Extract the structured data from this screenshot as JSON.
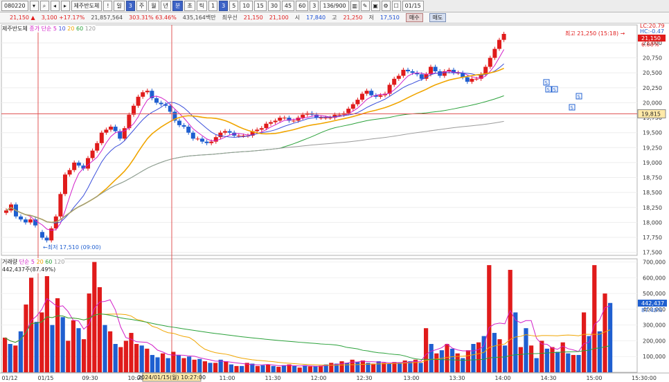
{
  "toolbar": {
    "code": "080220",
    "name": "제주반도체",
    "period_buttons": [
      "일",
      "주",
      "월",
      "년",
      "분",
      "초",
      "틱"
    ],
    "minute_buttons": [
      "1",
      "3",
      "5",
      "10",
      "15",
      "30",
      "45",
      "60"
    ],
    "interval_value": "3",
    "count_value": "136/900",
    "date_value": "01/15"
  },
  "info": {
    "price": "21,150 ▲",
    "change": "3,100 +17.17%",
    "volume": "21,857,564",
    "volume_ratio": "303.31% 63.46%",
    "amount": "435,164백만",
    "priority_label": "최우선",
    "priority_ask": "21,150",
    "priority_bid": "21,100",
    "open_label": "시",
    "open": "17,840",
    "high_label": "고",
    "high": "21,250",
    "low_label": "저",
    "low": "17,510",
    "sell_label": "매수",
    "buy_label": "매도"
  },
  "price_legend": {
    "name": "제주반도체",
    "ma_label": "종가 단순",
    "ma_periods": [
      "5",
      "10",
      "20",
      "60",
      "120"
    ]
  },
  "volume_legend": {
    "title": "거래량",
    "ma_label": "단순",
    "ma_periods": [
      "5",
      "20",
      "60",
      "120"
    ],
    "value": "442,437주(87.49%)"
  },
  "annotations": {
    "high": "최고 21,250 (15:18)",
    "low": "최저 17,510 (09:00)",
    "lc": "LC:20.79",
    "hc": "HC:-0.47",
    "current_price": "21,150",
    "current_pct": "6.08%",
    "crosshair_price": "19,815",
    "crosshair_time": "2024/01/15(월) 10:27:00",
    "volume_now": "442,437",
    "volume_pct": "87.49%",
    "signal_mark": "S"
  },
  "colors": {
    "up": "#e01b1b",
    "down": "#1f5fd0",
    "ma5": "#d21ec8",
    "ma10": "#3b4fdb",
    "ma20": "#f0a500",
    "ma60": "#2aa13a",
    "ma120": "#9a9a9a"
  },
  "chart_data": {
    "type": "candlestick",
    "price_axis": {
      "ticks": [
        "21,000",
        "20,750",
        "20,500",
        "20,250",
        "20,000",
        "19,750",
        "19,500",
        "19,250",
        "19,000",
        "18,750",
        "18,500",
        "18,250",
        "18,000",
        "17,750",
        "17,500"
      ]
    },
    "volume_axis": {
      "ticks": [
        "700,000",
        "600,000",
        "500,000",
        "400,000",
        "300,000",
        "200,000",
        "100,000"
      ]
    },
    "time_axis": {
      "labels": [
        "01/12",
        "01/15",
        "09:30",
        "10:00",
        "11:00",
        "11:30",
        "12:00",
        "12:30",
        "13:00",
        "13:30",
        "14:00",
        "14:30",
        "15:00",
        "15:30:00"
      ]
    },
    "session_close_prices": [
      18200,
      18300,
      18100,
      18050,
      18000,
      18050,
      17950
    ],
    "day_open": 17840,
    "close_path": [
      17700,
      18100,
      18800,
      19000,
      18900,
      19200,
      19500,
      19600,
      19400,
      19800,
      20100,
      20200,
      20000,
      19950,
      19700,
      19600,
      19400,
      19350,
      19350,
      19500,
      19500,
      19450,
      19450,
      19550,
      19650,
      19700,
      19750,
      19700,
      19800,
      19800,
      19750,
      19750,
      19800,
      19900,
      20050,
      20200,
      20100,
      20150,
      20400,
      20550,
      20500,
      20400,
      20600,
      20450,
      20550,
      20500,
      20350,
      20400,
      20600,
      20900,
      21150
    ],
    "volume_bars": [
      [
        "up",
        220
      ],
      [
        "dn",
        180
      ],
      [
        "up",
        170
      ],
      [
        "dn",
        260
      ],
      [
        "up",
        430
      ],
      [
        "up",
        600
      ],
      [
        "dn",
        320
      ],
      [
        "up",
        380
      ],
      [
        "up",
        610
      ],
      [
        "dn",
        300
      ],
      [
        "up",
        470
      ],
      [
        "dn",
        350
      ],
      [
        "up",
        200
      ],
      [
        "up",
        330
      ],
      [
        "dn",
        280
      ],
      [
        "up",
        210
      ],
      [
        "up",
        500
      ],
      [
        "up",
        700
      ],
      [
        "up",
        540
      ],
      [
        "dn",
        300
      ],
      [
        "up",
        260
      ],
      [
        "dn",
        180
      ],
      [
        "up",
        160
      ],
      [
        "up",
        200
      ],
      [
        "up",
        250
      ],
      [
        "up",
        180
      ],
      [
        "dn",
        170
      ],
      [
        "up",
        150
      ],
      [
        "dn",
        110
      ],
      [
        "dn",
        95
      ],
      [
        "up",
        120
      ],
      [
        "dn",
        90
      ],
      [
        "up",
        130
      ],
      [
        "dn",
        110
      ],
      [
        "up",
        90
      ],
      [
        "dn",
        100
      ],
      [
        "up",
        80
      ],
      [
        "dn",
        85
      ],
      [
        "up",
        70
      ],
      [
        "dn",
        60
      ],
      [
        "up",
        60
      ],
      [
        "dn",
        80
      ],
      [
        "up",
        70
      ],
      [
        "dn",
        50
      ],
      [
        "up",
        40
      ],
      [
        "dn",
        40
      ],
      [
        "up",
        60
      ],
      [
        "dn",
        55
      ],
      [
        "up",
        40
      ],
      [
        "dn",
        45
      ],
      [
        "up",
        50
      ],
      [
        "dn",
        40
      ],
      [
        "up",
        35
      ],
      [
        "dn",
        45
      ],
      [
        "up",
        50
      ],
      [
        "dn",
        40
      ],
      [
        "up",
        30
      ],
      [
        "dn",
        45
      ],
      [
        "up",
        38
      ],
      [
        "dn",
        40
      ],
      [
        "up",
        42
      ],
      [
        "dn",
        50
      ],
      [
        "up",
        60
      ],
      [
        "dn",
        55
      ],
      [
        "up",
        70
      ],
      [
        "dn",
        60
      ],
      [
        "up",
        80
      ],
      [
        "dn",
        65
      ],
      [
        "up",
        75
      ],
      [
        "dn",
        60
      ],
      [
        "up",
        55
      ],
      [
        "dn",
        70
      ],
      [
        "up",
        60
      ],
      [
        "dn",
        55
      ],
      [
        "up",
        65
      ],
      [
        "dn",
        60
      ],
      [
        "up",
        75
      ],
      [
        "dn",
        70
      ],
      [
        "up",
        80
      ],
      [
        "dn",
        60
      ],
      [
        "up",
        280
      ],
      [
        "dn",
        180
      ],
      [
        "up",
        120
      ],
      [
        "dn",
        140
      ],
      [
        "up",
        180
      ],
      [
        "dn",
        150
      ],
      [
        "up",
        120
      ],
      [
        "dn",
        90
      ],
      [
        "up",
        140
      ],
      [
        "dn",
        180
      ],
      [
        "up",
        190
      ],
      [
        "dn",
        230
      ],
      [
        "up",
        680
      ],
      [
        "dn",
        250
      ],
      [
        "up",
        210
      ],
      [
        "dn",
        170
      ],
      [
        "up",
        650
      ],
      [
        "dn",
        380
      ],
      [
        "up",
        160
      ],
      [
        "dn",
        280
      ],
      [
        "up",
        170
      ],
      [
        "dn",
        90
      ],
      [
        "up",
        200
      ],
      [
        "dn",
        150
      ],
      [
        "up",
        160
      ],
      [
        "dn",
        130
      ],
      [
        "up",
        190
      ],
      [
        "dn",
        120
      ],
      [
        "up",
        110
      ],
      [
        "dn",
        110
      ],
      [
        "up",
        380
      ],
      [
        "dn",
        230
      ],
      [
        "up",
        680
      ],
      [
        "dn",
        260
      ],
      [
        "up",
        500
      ],
      [
        "dn",
        440
      ]
    ]
  }
}
